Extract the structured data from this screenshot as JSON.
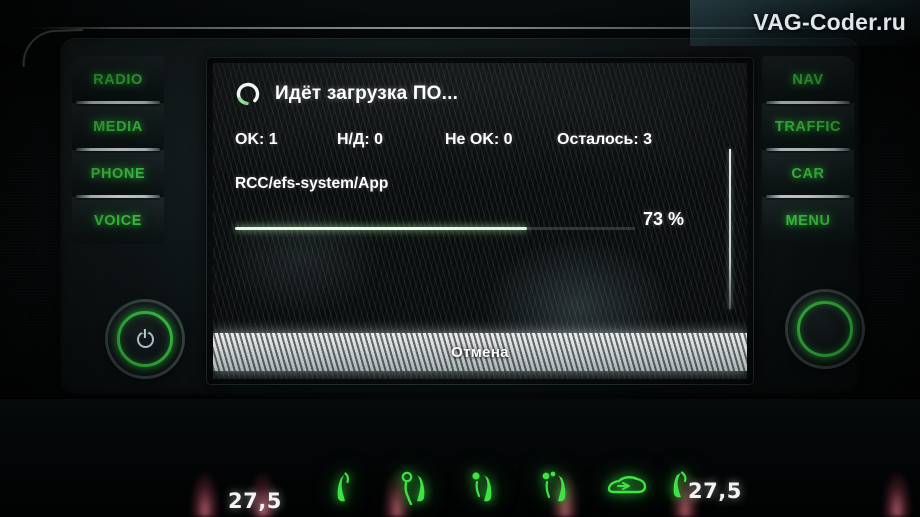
{
  "watermark": {
    "text": "VAG-Coder.ru"
  },
  "head_unit": {
    "left_buttons": [
      {
        "label": "RADIO",
        "name": "radio-button"
      },
      {
        "label": "MEDIA",
        "name": "media-button"
      },
      {
        "label": "PHONE",
        "name": "phone-button"
      },
      {
        "label": "VOICE",
        "name": "voice-button"
      }
    ],
    "right_buttons": [
      {
        "label": "NAV",
        "name": "nav-button"
      },
      {
        "label": "TRAFFIC",
        "name": "traffic-button"
      },
      {
        "label": "CAR",
        "name": "car-button"
      },
      {
        "label": "MENU",
        "name": "menu-button"
      }
    ],
    "left_knob": {
      "name": "power-volume-knob",
      "glyph": "power-icon",
      "ring_color": "#3ee04a"
    },
    "right_knob": {
      "name": "tune-knob",
      "ring_color": "#3ee04a"
    }
  },
  "screen": {
    "title": "Идёт загрузка ПО...",
    "spinner_icon": "loading-spinner-icon",
    "stats": [
      {
        "label": "OK:",
        "value": "1"
      },
      {
        "label": "Н/Д:",
        "value": "0"
      },
      {
        "label": "Не OK:",
        "value": "0"
      },
      {
        "label": "Осталось:",
        "value": "3"
      }
    ],
    "stats_text": [
      "OK: 1",
      "Н/Д: 0",
      "Не OK: 0",
      "Осталось: 3"
    ],
    "current_path": "RCC/efs-system/App",
    "progress": {
      "percent_label": "73 %",
      "percent_value": 73
    },
    "cancel_label": "Отмена",
    "accent_color": "#eaf7e5"
  },
  "climate": {
    "left_temperature": "27,5",
    "right_temperature": "27,5",
    "icons": [
      {
        "name": "airflow-feet-left-icon"
      },
      {
        "name": "airflow-body-feet-left-icon"
      },
      {
        "name": "airflow-body-center-icon"
      },
      {
        "name": "airflow-body-right-icon"
      },
      {
        "name": "air-recirculation-icon"
      },
      {
        "name": "airflow-defrost-right-icon"
      }
    ],
    "icon_color": "#3fe343"
  }
}
